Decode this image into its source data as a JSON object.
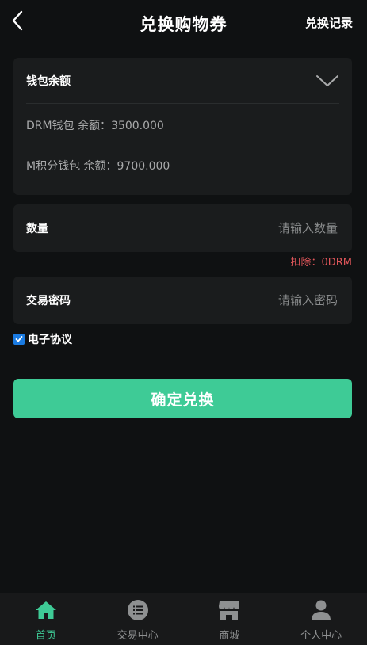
{
  "header": {
    "title": "兑换购物券",
    "right_link": "兑换记录"
  },
  "wallet": {
    "label": "钱包余额",
    "lines": [
      "DRM钱包 余额：3500.000",
      "M积分钱包 余额：9700.000"
    ]
  },
  "quantity": {
    "label": "数量",
    "placeholder": "请输入数量",
    "value": ""
  },
  "deduct_text": "扣除：0DRM",
  "password": {
    "label": "交易密码",
    "placeholder": "请输入密码",
    "value": ""
  },
  "agreement": {
    "label": "电子协议",
    "checked": true
  },
  "submit_label": "确定兑换",
  "tabs": [
    {
      "label": "首页",
      "icon": "home-icon",
      "active": true
    },
    {
      "label": "交易中心",
      "icon": "list-icon",
      "active": false
    },
    {
      "label": "商城",
      "icon": "store-icon",
      "active": false
    },
    {
      "label": "个人中心",
      "icon": "user-icon",
      "active": false
    }
  ],
  "colors": {
    "background": "#0f1112",
    "card": "#1a1c1d",
    "accent": "#3ecb96",
    "warning": "#e0565a",
    "checkbox": "#1a7be2"
  }
}
